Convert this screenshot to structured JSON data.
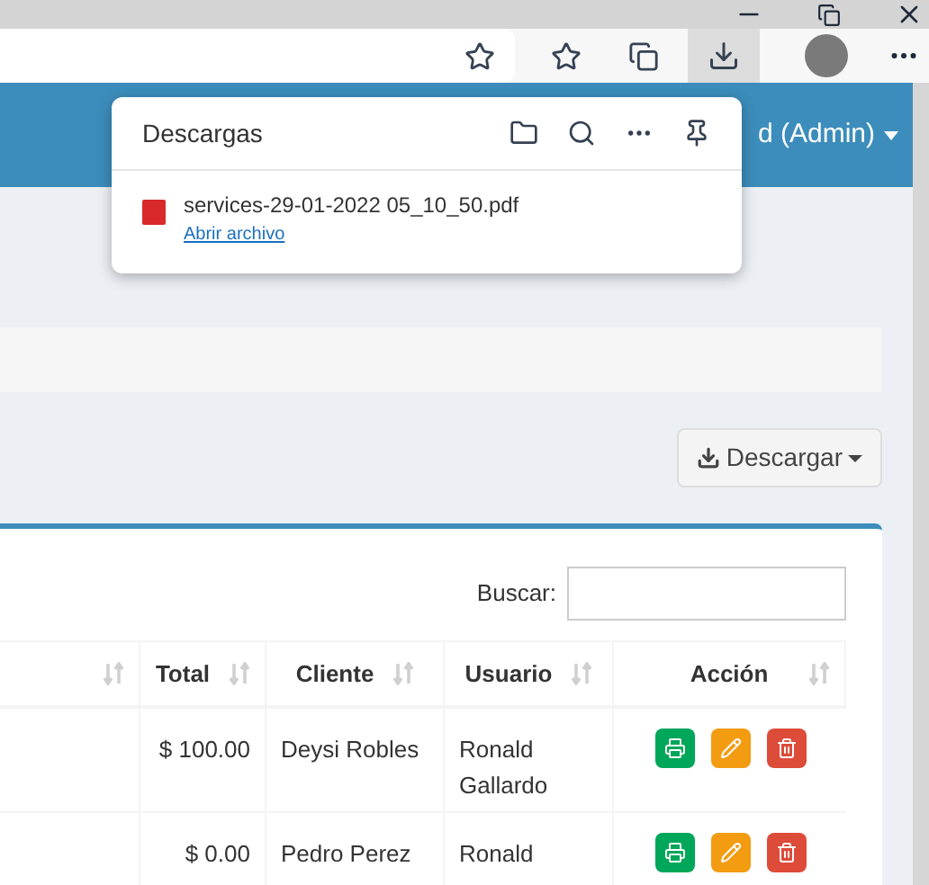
{
  "header": {
    "user_menu": "d (Admin)"
  },
  "downloads_panel": {
    "title": "Descargas",
    "files": [
      {
        "name": "services-29-01-2022 05_10_50.pdf",
        "link": "Abrir archivo"
      }
    ]
  },
  "download_button": {
    "label": "Descargar"
  },
  "search": {
    "label": "Buscar:"
  },
  "table": {
    "columns": [
      {
        "label": "Total"
      },
      {
        "label": "Cliente"
      },
      {
        "label": "Usuario"
      },
      {
        "label": "Acción"
      }
    ],
    "rows": [
      {
        "total": "$ 100.00",
        "cliente": "Deysi Robles",
        "usuario": "Ronald Gallardo"
      },
      {
        "total": "$ 0.00",
        "cliente": "Pedro Perez",
        "usuario": "Ronald"
      }
    ]
  }
}
